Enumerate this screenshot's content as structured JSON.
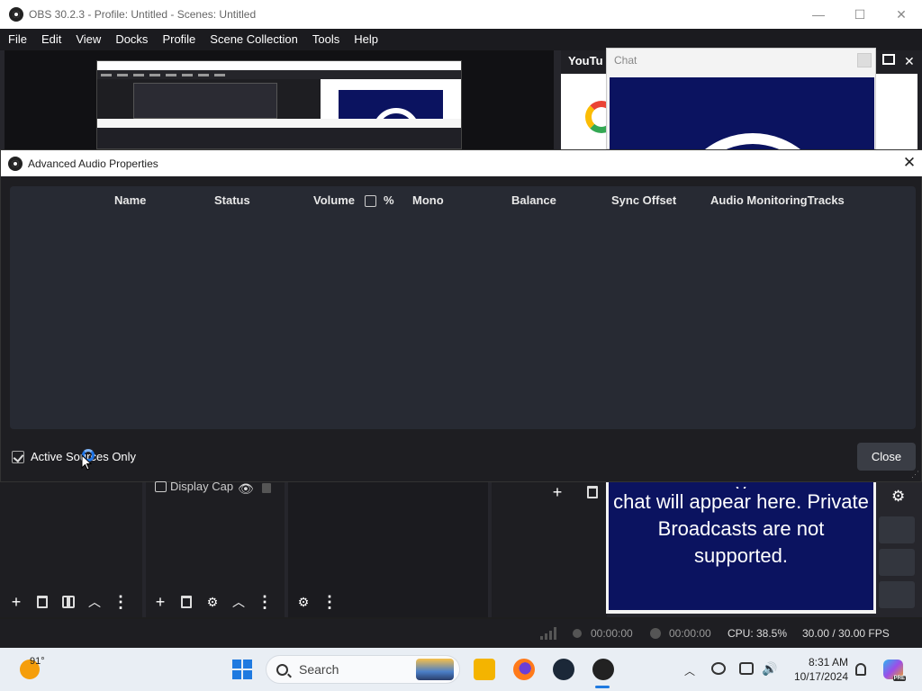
{
  "obs_window": {
    "title": "OBS 30.2.3 - Profile: Untitled - Scenes: Untitled",
    "controls": {
      "minimize": "—",
      "maximize": "☐",
      "close": "✕"
    }
  },
  "menu": [
    "File",
    "Edit",
    "View",
    "Docks",
    "Profile",
    "Scene Collection",
    "Tools",
    "Help"
  ],
  "preview": {
    "dock_title": "YouTu",
    "chat_popup_title": "Chat"
  },
  "dialog": {
    "title": "Advanced Audio Properties",
    "close_glyph": "✕",
    "columns": {
      "name": "Name",
      "status": "Status",
      "volume": "Volume",
      "volume_percent": "%",
      "mono": "Mono",
      "balance": "Balance",
      "sync_offset": "Sync Offset",
      "audio_monitoring_tracks": "Audio MonitoringTracks"
    },
    "volume_percent_checked": false,
    "active_sources_only": {
      "label": "Active Sources Only",
      "checked": true
    },
    "close_button": "Close"
  },
  "sources": {
    "item": "Display Cap",
    "visible_icon": "eye-icon",
    "lock_icon": "lock-icon"
  },
  "chat": {
    "line_partial": "y",
    "message": "chat will appear here. Private Broadcasts are not supported."
  },
  "status": {
    "stream_time": "00:00:00",
    "record_time": "00:00:00",
    "cpu": "CPU: 38.5%",
    "fps": "30.00 / 30.00 FPS"
  },
  "taskbar": {
    "weather_temp": "91°",
    "search_placeholder": "Search",
    "time": "8:31 AM",
    "date": "10/17/2024"
  }
}
